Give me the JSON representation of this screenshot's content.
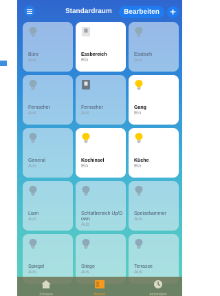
{
  "header": {
    "title": "Standardraum",
    "edit_label": "Bearbeiten",
    "add_label": "+"
  },
  "accessories": [
    {
      "name": "Büro",
      "state": "Aus",
      "on": false,
      "type": "bulb"
    },
    {
      "name": "Essbereich",
      "state": "Ein",
      "on": true,
      "type": "switch"
    },
    {
      "name": "Esstisch",
      "state": "Aus",
      "on": false,
      "type": "bulb"
    },
    {
      "name": "Fernseher",
      "state": "Aus",
      "on": false,
      "type": "bulb"
    },
    {
      "name": "Fernseher",
      "state": "Aus",
      "on": false,
      "type": "switch"
    },
    {
      "name": "Gang",
      "state": "Ein",
      "on": true,
      "type": "bulb"
    },
    {
      "name": "General",
      "state": "Aus",
      "on": false,
      "type": "bulb"
    },
    {
      "name": "Kochinsel",
      "state": "Ein",
      "on": true,
      "type": "bulb"
    },
    {
      "name": "Küche",
      "state": "Ein",
      "on": true,
      "type": "bulb"
    },
    {
      "name": "Liam",
      "state": "Aus",
      "on": false,
      "type": "bulb"
    },
    {
      "name": "Schlafbereich Up/Down",
      "state": "Aus",
      "on": false,
      "type": "bulb"
    },
    {
      "name": "Speisekammer",
      "state": "Aus",
      "on": false,
      "type": "bulb"
    },
    {
      "name": "Spiegel",
      "state": "Aus",
      "on": false,
      "type": "bulb"
    },
    {
      "name": "Stiege",
      "state": "Aus",
      "on": false,
      "type": "bulb"
    },
    {
      "name": "Terrasse",
      "state": "Aus",
      "on": false,
      "type": "bulb"
    }
  ],
  "tabs": [
    {
      "label": "Zuhause",
      "icon": "house-icon",
      "active": false
    },
    {
      "label": "Räume",
      "icon": "rooms-icon",
      "active": true
    },
    {
      "label": "Automation",
      "icon": "automation-icon",
      "active": false
    }
  ],
  "colors": {
    "accent": "#1f7cf0",
    "bulb_on": "#ffcc00",
    "bulb_off": "#8ea9b8",
    "tab_active": "#f39a1e"
  }
}
